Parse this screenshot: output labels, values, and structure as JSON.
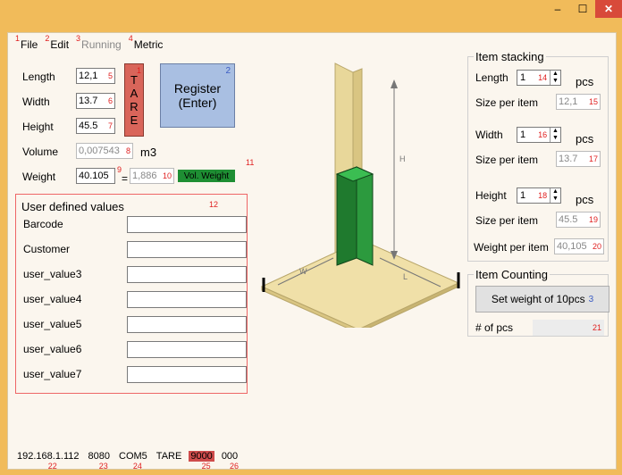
{
  "window": {
    "minimize_label": "–",
    "maximize_label": "☐",
    "close_label": "✕"
  },
  "menu": [
    {
      "num": "1",
      "label": "File",
      "enabled": true
    },
    {
      "num": "2",
      "label": "Edit",
      "enabled": true
    },
    {
      "num": "3",
      "label": "Running",
      "enabled": false
    },
    {
      "num": "4",
      "label": "Metric",
      "enabled": true
    }
  ],
  "dimensions": {
    "length_label": "Length",
    "length_value": "12,1",
    "length_num": "5",
    "width_label": "Width",
    "width_value": "13.7",
    "width_num": "6",
    "height_label": "Height",
    "height_value": "45.5",
    "height_num": "7",
    "volume_label": "Volume",
    "volume_value": "0,007543",
    "volume_num": "8",
    "volume_unit": "m3",
    "weight_label": "Weight",
    "weight_value": "40.105",
    "weight_num": "9",
    "equals": "=",
    "volweight_value": "1,886",
    "volweight_num": "10",
    "volweight_button": "Vol. Weight",
    "volweight_badge_num": "11"
  },
  "tare": {
    "letters": [
      "T",
      "A",
      "R",
      "E"
    ],
    "num": "1"
  },
  "register": {
    "line1": "Register",
    "line2": "(Enter)",
    "num": "2"
  },
  "user_defined": {
    "title": "User defined values",
    "num": "12",
    "fields": [
      {
        "label": "Barcode",
        "value": ""
      },
      {
        "label": "Customer",
        "value": ""
      },
      {
        "label": "user_value3",
        "value": ""
      },
      {
        "label": "user_value4",
        "value": ""
      },
      {
        "label": "user_value5",
        "value": ""
      },
      {
        "label": "user_value6",
        "value": ""
      },
      {
        "label": "user_value7",
        "value": ""
      }
    ]
  },
  "illustration": {
    "h_label": "H",
    "w_label": "W",
    "l_label": "L"
  },
  "item_stacking": {
    "title": "Item stacking",
    "length_label": "Length",
    "length_value": "1",
    "length_num": "14",
    "pcs": "pcs",
    "size_label": "Size per item",
    "length_size": "12,1",
    "length_size_num": "15",
    "width_label": "Width",
    "width_value": "1",
    "width_num": "16",
    "width_size": "13.7",
    "width_size_num": "17",
    "height_label": "Height",
    "height_value": "1",
    "height_num": "18",
    "height_size": "45.5",
    "height_size_num": "19",
    "weight_per_item_label": "Weight per item",
    "weight_per_item": "40,105",
    "weight_per_item_num": "20"
  },
  "item_counting": {
    "title": "Item Counting",
    "button_label": "Set weight of 10pcs",
    "button_num": "3",
    "pcs_label": "# of pcs",
    "pcs_num": "21"
  },
  "status": [
    {
      "text": "192.168.1.112",
      "num": "22",
      "highlight": false
    },
    {
      "text": "8080",
      "num": "23",
      "highlight": false
    },
    {
      "text": "COM5",
      "num": "24",
      "highlight": false
    },
    {
      "text": "TARE",
      "num": "",
      "highlight": false
    },
    {
      "text": "9000",
      "num": "25",
      "highlight": true
    },
    {
      "text": "000",
      "num": "26",
      "highlight": false
    }
  ]
}
